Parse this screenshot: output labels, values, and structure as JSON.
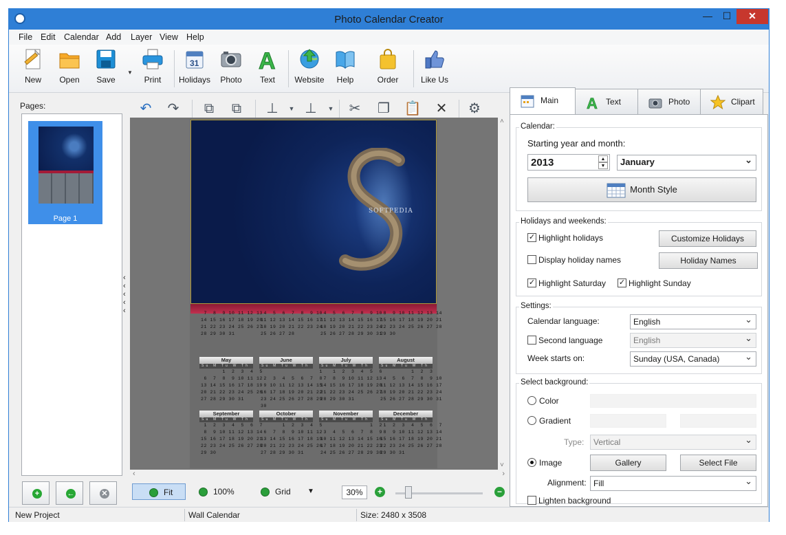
{
  "window": {
    "title": "Photo Calendar Creator"
  },
  "menu": [
    "File",
    "Edit",
    "Calendar",
    "Add",
    "Layer",
    "View",
    "Help"
  ],
  "toolbar": {
    "new": "New",
    "open": "Open",
    "save": "Save",
    "print": "Print",
    "holidays": "Holidays",
    "photo": "Photo",
    "text": "Text",
    "website": "Website",
    "help": "Help",
    "order": "Order",
    "like_us": "Like Us"
  },
  "pages": {
    "title": "Pages:",
    "items": [
      "Page 1"
    ]
  },
  "canvas": {
    "watermark": "SOFTPEDIA",
    "months": [
      {
        "name": "",
        "rows": [
          "          1  2  3  4  5  6",
          " 7  8  9 10 11 12 13",
          "14 15 16 17 18 19 20",
          "21 22 23 24 25 26 27",
          "28 29 30 31"
        ]
      },
      {
        "name": "",
        "rows": [
          "             1  2  3",
          " 4  5  6  7  8  9 10",
          "11 12 13 14 15 16 17",
          "18 19 20 21 22 23 24",
          "25 26 27 28"
        ]
      },
      {
        "name": "",
        "rows": [
          "             1  2  3",
          " 4  5  6  7  8  9 10",
          "11 12 13 14 15 16 17",
          "18 19 20 21 22 23 24",
          "25 26 27 28 29 30 31"
        ]
      },
      {
        "name": "",
        "rows": [
          " 1  2  3  4  5  6  7",
          " 8  9 10 11 12 13 14",
          "15 16 17 18 19 20 21",
          "22 23 24 25 26 27 28",
          "29 30"
        ]
      },
      {
        "name": "May",
        "rows": [
          "       1  2  3  4  5",
          " 6  7  8  9 10 11 12",
          "13 14 15 16 17 18 19",
          "20 21 22 23 24 25 26",
          "27 28 29 30 31"
        ]
      },
      {
        "name": "June",
        "rows": [
          "                   1",
          " 2  3  4  5  6  7  8",
          " 9 10 11 12 13 14 15",
          "16 17 18 19 20 21 22",
          "23 24 25 26 27 28 29",
          "30"
        ]
      },
      {
        "name": "July",
        "rows": [
          "    1  2  3  4  5  6",
          " 7  8  9 10 11 12 13",
          "14 15 16 17 18 19 20",
          "21 22 23 24 25 26 27",
          "28 29 30 31"
        ]
      },
      {
        "name": "August",
        "rows": [
          "          1  2  3",
          " 4  5  6  7  8  9 10",
          "11 12 13 14 15 16 17",
          "18 19 20 21 22 23 24",
          "25 26 27 28 29 30 31"
        ]
      },
      {
        "name": "September",
        "rows": [
          " 1  2  3  4  5  6  7",
          " 8  9 10 11 12 13 14",
          "15 16 17 18 19 20 21",
          "22 23 24 25 26 27 28",
          "29 30"
        ]
      },
      {
        "name": "October",
        "rows": [
          "       1  2  3  4  5",
          " 6  7  8  9 10 11 12",
          "13 14 15 16 17 18 19",
          "20 21 22 23 24 25 26",
          "27 28 29 30 31"
        ]
      },
      {
        "name": "November",
        "rows": [
          "                1  2",
          " 3  4  5  6  7  8  9",
          "10 11 12 13 14 15 16",
          "17 18 19 20 21 22 23",
          "24 25 26 27 28 29 30"
        ]
      },
      {
        "name": "December",
        "rows": [
          " 1  2  3  4  5  6  7",
          " 8  9 10 11 12 13 14",
          "15 16 17 18 19 20 21",
          "22 23 24 25 26 27 28",
          "29 30 31"
        ]
      }
    ],
    "weekdays": "Su M Tu W Th Fr Sa"
  },
  "zoom": {
    "fit": "Fit",
    "hundred": "100%",
    "grid": "Grid",
    "value": "30%"
  },
  "tabs": {
    "main": "Main",
    "text": "Text",
    "photo": "Photo",
    "clipart": "Clipart"
  },
  "calendar_group": {
    "title": "Calendar:",
    "starting_label": "Starting year and month:",
    "year": "2013",
    "month": "January",
    "month_style": "Month Style"
  },
  "holidays_group": {
    "title": "Holidays and weekends:",
    "highlight_holidays": "Highlight holidays",
    "customize_holidays": "Customize Holidays",
    "display_holiday_names": "Display holiday names",
    "holiday_names": "Holiday Names",
    "highlight_saturday": "Highlight Saturday",
    "highlight_sunday": "Highlight Sunday"
  },
  "settings_group": {
    "title": "Settings:",
    "calendar_language_label": "Calendar language:",
    "calendar_language": "English",
    "second_language_label": "Second language",
    "second_language": "English",
    "week_starts_label": "Week starts on:",
    "week_starts": "Sunday (USA, Canada)"
  },
  "background_group": {
    "title": "Select background:",
    "color": "Color",
    "gradient": "Gradient",
    "type_label": "Type:",
    "type": "Vertical",
    "image": "Image",
    "gallery": "Gallery",
    "select_file": "Select File",
    "alignment_label": "Alignment:",
    "alignment": "Fill",
    "lighten": "Lighten background"
  },
  "status": {
    "project": "New Project",
    "type": "Wall Calendar",
    "size": "Size: 2480 x 3508"
  },
  "colors": {
    "titlebar": "#2f7fd6",
    "accent_red": "#b01a32",
    "selection": "#3f8fe9"
  }
}
